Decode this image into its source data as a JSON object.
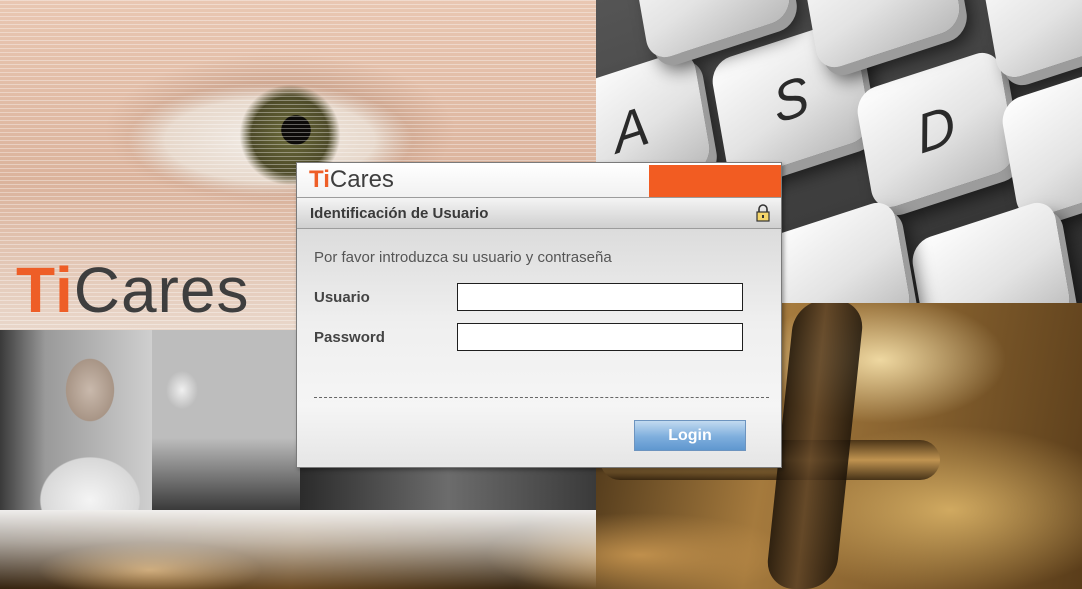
{
  "background": {
    "logo_ti": "Ti",
    "logo_cares": "Cares",
    "keys": [
      "A",
      "S",
      "D"
    ]
  },
  "dialog": {
    "logo_ti": "Ti",
    "logo_cares": "Cares",
    "title": "Identificación de Usuario",
    "prompt": "Por favor introduzca su usuario y contraseña",
    "username_label": "Usuario",
    "username_value": "",
    "password_label": "Password",
    "password_value": "",
    "login_label": "Login"
  },
  "colors": {
    "brand_orange": "#f25c22",
    "button_blue": "#7eaedd"
  }
}
